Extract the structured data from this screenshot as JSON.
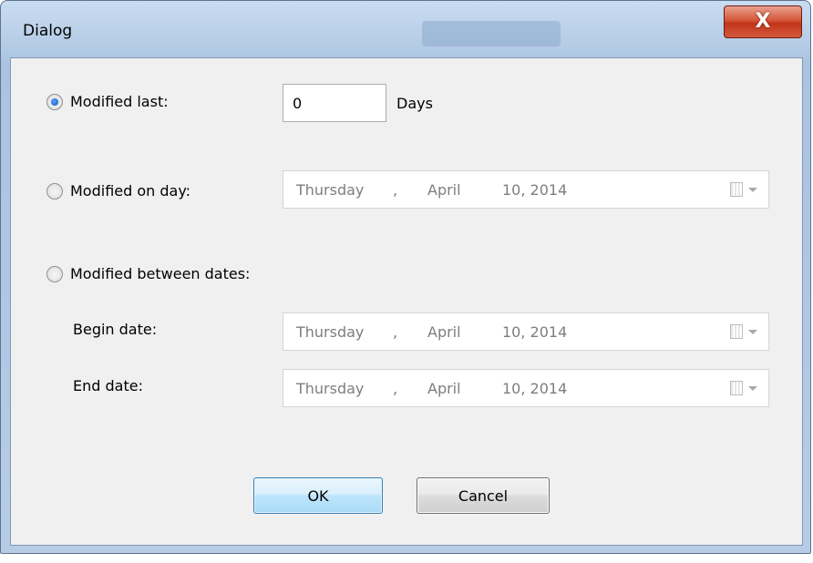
{
  "window": {
    "title": "Dialog",
    "close_glyph": "X"
  },
  "options": {
    "modified_last": {
      "label": "Modified last:",
      "value": "0",
      "unit": "Days",
      "checked": true
    },
    "modified_on_day": {
      "label": "Modified on day:",
      "checked": false
    },
    "modified_between": {
      "label": "Modified between dates:",
      "checked": false
    }
  },
  "dates": {
    "on_day": {
      "weekday": "Thursday",
      "sep": ",",
      "month": "April",
      "day_year": "10, 2014"
    },
    "begin": {
      "label": "Begin date:",
      "weekday": "Thursday",
      "sep": ",",
      "month": "April",
      "day_year": "10, 2014"
    },
    "end": {
      "label": "End date:",
      "weekday": "Thursday",
      "sep": ",",
      "month": "April",
      "day_year": "10, 2014"
    }
  },
  "buttons": {
    "ok": "OK",
    "cancel": "Cancel"
  },
  "icons": {
    "close": "close-icon",
    "calendar": "calendar-icon",
    "dropdown": "chevron-down-icon"
  },
  "colors": {
    "client_bg": "#f0f0f0",
    "close_red": "#c2341a",
    "ok_border": "#3c7fb1",
    "disabled_text": "#7e7e7e"
  }
}
